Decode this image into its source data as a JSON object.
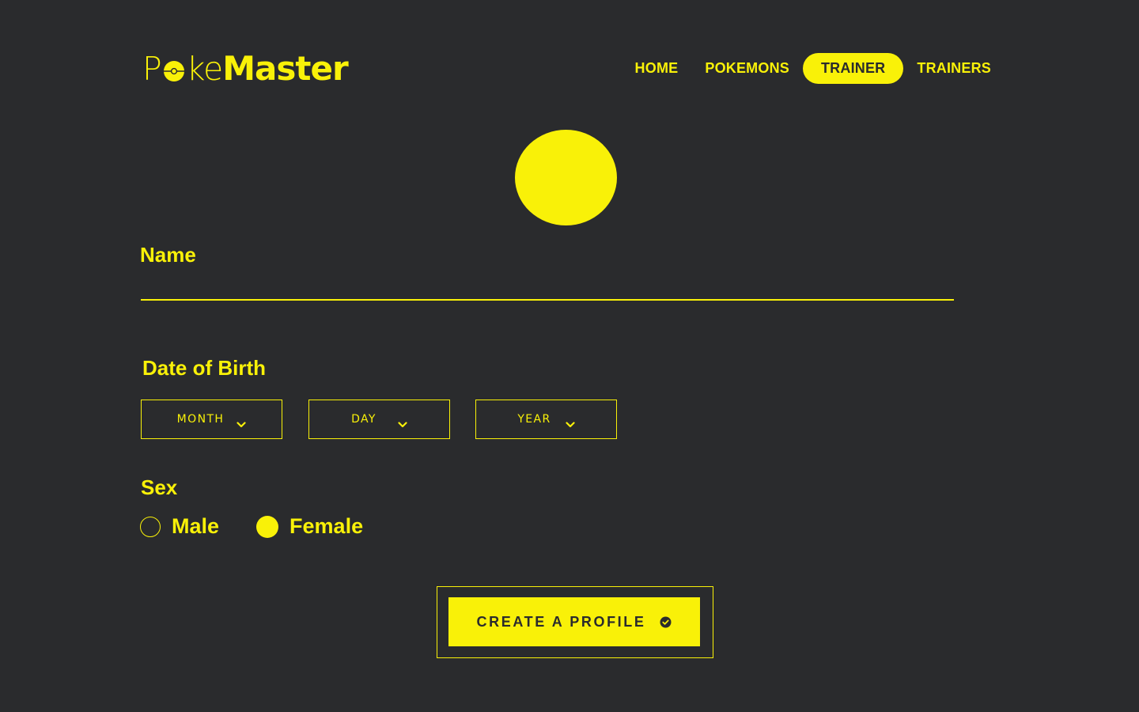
{
  "brand": {
    "logo_part_1": "P",
    "logo_part_2": "ke",
    "logo_bold": "Master"
  },
  "nav": {
    "items": [
      {
        "label": "HOME",
        "active": false
      },
      {
        "label": "POKEMONS",
        "active": false
      },
      {
        "label": "TRAINER",
        "active": true
      },
      {
        "label": "TRAINERS",
        "active": false
      }
    ]
  },
  "form": {
    "name_label": "Name",
    "name_value": "",
    "dob_label": "Date of Birth",
    "month_label": "MONTH",
    "day_label": "DAY",
    "year_label": "YEAR",
    "sex_label": "Sex",
    "sex_options": [
      {
        "label": "Male",
        "selected": false
      },
      {
        "label": "Female",
        "selected": true
      }
    ],
    "submit_label": "CREATE A PROFILE"
  },
  "colors": {
    "accent": "#f9f108",
    "background": "#2a2b2d"
  },
  "icons": {
    "logo_o": "pokeball-icon",
    "select_arrow": "chevron-down-icon",
    "submit": "check-circle-icon"
  }
}
